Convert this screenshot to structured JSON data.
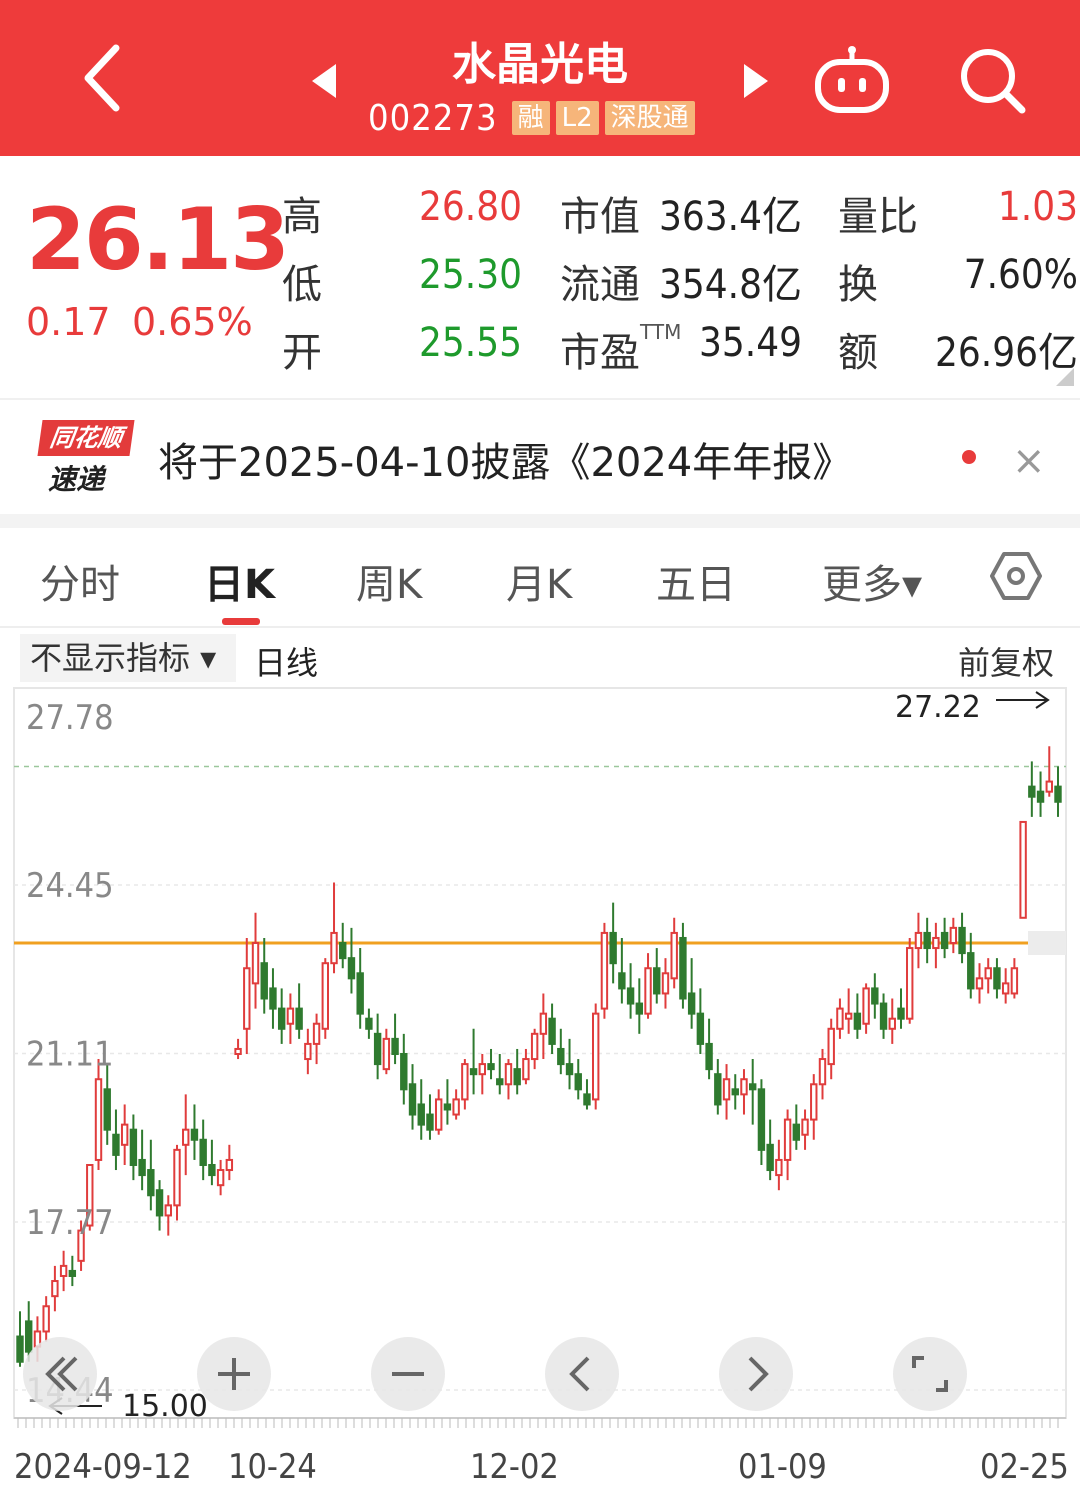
{
  "header": {
    "title": "水晶光电",
    "code": "002273",
    "tags": [
      "融",
      "L2",
      "深股通"
    ]
  },
  "quote": {
    "price": "26.13",
    "change": "0.17",
    "change_pct": "0.65%",
    "stats": {
      "high_label": "高",
      "high": "26.80",
      "low_label": "低",
      "low": "25.30",
      "open_label": "开",
      "open": "25.55",
      "mcap_label": "市值",
      "mcap": "363.4亿",
      "float_label": "流通",
      "float": "354.8亿",
      "pe_label": "市盈",
      "pe_sup": "TTM",
      "pe": "35.49",
      "vol_ratio_label": "量比",
      "vol_ratio": "1.03",
      "turnover_label": "换",
      "turnover": "7.60%",
      "amount_label": "额",
      "amount": "26.96亿"
    }
  },
  "news": {
    "logo_top": "同花顺",
    "logo_bottom": "速递",
    "text": "将于2025-04-10披露《2024年年报》",
    "close": "×"
  },
  "tabs": [
    "分时",
    "日K",
    "周K",
    "月K",
    "五日",
    "更多▾"
  ],
  "active_tab": 1,
  "chart_header": {
    "indicator": "不显示指标 ▾",
    "period": "日线",
    "adjust": "前复权"
  },
  "chart_data": {
    "type": "candlestick",
    "y_ticks": [
      "27.78",
      "24.45",
      "21.11",
      "17.77",
      "14.44"
    ],
    "ylim": [
      14.44,
      27.78
    ],
    "x_ticks": [
      "2024-09-12",
      "10-24",
      "12-02",
      "01-09",
      "02-25"
    ],
    "max_label": "27.22",
    "min_label": "15.00",
    "reference_line": 23.3,
    "candles": [
      [
        15.5,
        16.0,
        14.9,
        15.0
      ],
      [
        15.8,
        16.2,
        15.0,
        15.2
      ],
      [
        15.3,
        15.9,
        15.0,
        15.6
      ],
      [
        15.6,
        16.3,
        15.4,
        16.1
      ],
      [
        16.3,
        16.9,
        16.0,
        16.6
      ],
      [
        16.7,
        17.2,
        16.4,
        16.9
      ],
      [
        16.8,
        17.1,
        16.5,
        16.7
      ],
      [
        17.0,
        17.8,
        16.8,
        17.6
      ],
      [
        17.7,
        18.9,
        17.6,
        18.9
      ],
      [
        19.0,
        21.0,
        18.8,
        20.6
      ],
      [
        20.4,
        20.9,
        19.3,
        19.6
      ],
      [
        19.5,
        20.0,
        18.8,
        19.1
      ],
      [
        19.3,
        20.1,
        18.9,
        19.7
      ],
      [
        19.6,
        19.9,
        18.6,
        18.9
      ],
      [
        19.0,
        19.6,
        18.4,
        18.7
      ],
      [
        18.8,
        19.4,
        18.0,
        18.3
      ],
      [
        18.4,
        18.6,
        17.6,
        17.9
      ],
      [
        17.9,
        18.3,
        17.5,
        18.1
      ],
      [
        18.1,
        19.3,
        17.8,
        19.2
      ],
      [
        19.3,
        20.3,
        18.7,
        19.6
      ],
      [
        19.6,
        20.1,
        19.0,
        19.4
      ],
      [
        19.4,
        19.8,
        18.6,
        18.9
      ],
      [
        18.9,
        19.4,
        18.5,
        18.7
      ],
      [
        18.5,
        19.0,
        18.3,
        18.8
      ],
      [
        18.8,
        19.3,
        18.6,
        19.0
      ],
      [
        21.1,
        21.4,
        21.0,
        21.2
      ],
      [
        21.6,
        23.4,
        21.1,
        22.8
      ],
      [
        22.5,
        23.9,
        22.0,
        23.3
      ],
      [
        22.9,
        23.4,
        21.9,
        22.2
      ],
      [
        22.4,
        22.8,
        21.6,
        22.0
      ],
      [
        22.0,
        22.4,
        21.3,
        21.6
      ],
      [
        21.7,
        22.3,
        21.3,
        22.0
      ],
      [
        22.0,
        22.5,
        21.4,
        21.6
      ],
      [
        21.0,
        21.6,
        20.7,
        21.3
      ],
      [
        21.3,
        21.9,
        20.9,
        21.7
      ],
      [
        21.6,
        23.0,
        21.4,
        22.9
      ],
      [
        22.9,
        24.5,
        22.7,
        23.5
      ],
      [
        23.3,
        23.7,
        22.8,
        23.0
      ],
      [
        23.0,
        23.6,
        22.3,
        22.6
      ],
      [
        22.7,
        23.2,
        21.6,
        21.9
      ],
      [
        21.8,
        22.0,
        21.4,
        21.6
      ],
      [
        21.5,
        21.9,
        20.6,
        20.9
      ],
      [
        20.8,
        21.6,
        20.7,
        21.4
      ],
      [
        21.4,
        21.9,
        20.9,
        21.1
      ],
      [
        21.1,
        21.5,
        20.1,
        20.4
      ],
      [
        20.5,
        20.9,
        19.6,
        19.9
      ],
      [
        20.1,
        20.6,
        19.4,
        19.7
      ],
      [
        19.9,
        20.3,
        19.4,
        19.6
      ],
      [
        19.6,
        20.4,
        19.5,
        20.2
      ],
      [
        20.1,
        20.6,
        19.7,
        20.0
      ],
      [
        19.9,
        20.4,
        19.8,
        20.2
      ],
      [
        20.2,
        21.0,
        20.0,
        20.9
      ],
      [
        20.8,
        21.6,
        20.3,
        20.7
      ],
      [
        20.7,
        21.1,
        20.3,
        20.9
      ],
      [
        20.9,
        21.2,
        20.6,
        20.8
      ],
      [
        20.6,
        21.1,
        20.3,
        20.5
      ],
      [
        20.5,
        21.0,
        20.2,
        20.9
      ],
      [
        20.8,
        21.2,
        20.3,
        20.5
      ],
      [
        20.6,
        21.2,
        20.5,
        21.0
      ],
      [
        21.0,
        21.6,
        20.8,
        21.5
      ],
      [
        21.5,
        22.3,
        21.0,
        21.9
      ],
      [
        21.8,
        22.1,
        21.1,
        21.3
      ],
      [
        21.2,
        21.6,
        20.7,
        20.9
      ],
      [
        20.9,
        21.4,
        20.4,
        20.7
      ],
      [
        20.7,
        21.0,
        20.2,
        20.4
      ],
      [
        20.3,
        20.6,
        20.0,
        20.1
      ],
      [
        20.2,
        22.1,
        20.0,
        21.9
      ],
      [
        22.0,
        23.7,
        21.8,
        23.5
      ],
      [
        23.5,
        24.1,
        22.5,
        22.9
      ],
      [
        22.7,
        23.4,
        22.1,
        22.4
      ],
      [
        22.4,
        22.9,
        21.8,
        22.1
      ],
      [
        22.1,
        22.6,
        21.5,
        21.9
      ],
      [
        21.9,
        23.1,
        21.8,
        22.8
      ],
      [
        22.8,
        23.2,
        22.1,
        22.3
      ],
      [
        22.3,
        23.0,
        22.0,
        22.7
      ],
      [
        22.6,
        23.8,
        22.4,
        23.5
      ],
      [
        23.4,
        23.7,
        22.0,
        22.2
      ],
      [
        22.3,
        23.0,
        21.6,
        21.9
      ],
      [
        21.9,
        22.4,
        21.1,
        21.3
      ],
      [
        21.3,
        21.8,
        20.6,
        20.8
      ],
      [
        20.7,
        21.0,
        19.9,
        20.1
      ],
      [
        20.2,
        20.9,
        19.8,
        20.6
      ],
      [
        20.4,
        20.7,
        20.0,
        20.3
      ],
      [
        20.3,
        20.8,
        19.9,
        20.6
      ],
      [
        20.5,
        21.0,
        19.7,
        20.4
      ],
      [
        20.4,
        20.6,
        18.9,
        19.2
      ],
      [
        19.3,
        19.8,
        18.6,
        18.8
      ],
      [
        18.7,
        19.4,
        18.4,
        19.0
      ],
      [
        19.0,
        20.0,
        18.6,
        19.8
      ],
      [
        19.7,
        20.1,
        19.2,
        19.4
      ],
      [
        19.5,
        20.0,
        19.2,
        19.8
      ],
      [
        19.8,
        20.7,
        19.4,
        20.5
      ],
      [
        20.5,
        21.2,
        20.2,
        21.0
      ],
      [
        20.9,
        21.8,
        20.6,
        21.6
      ],
      [
        21.6,
        22.2,
        21.4,
        22.0
      ],
      [
        21.8,
        22.4,
        21.5,
        21.9
      ],
      [
        21.9,
        22.3,
        21.4,
        21.6
      ],
      [
        21.7,
        22.5,
        21.5,
        22.4
      ],
      [
        22.4,
        22.7,
        21.8,
        22.1
      ],
      [
        22.1,
        22.3,
        21.4,
        21.6
      ],
      [
        21.6,
        22.2,
        21.3,
        21.8
      ],
      [
        22.0,
        22.4,
        21.6,
        21.8
      ],
      [
        21.8,
        23.4,
        21.7,
        23.2
      ],
      [
        23.2,
        23.9,
        22.8,
        23.5
      ],
      [
        23.5,
        23.8,
        22.9,
        23.2
      ],
      [
        23.2,
        23.7,
        22.8,
        23.4
      ],
      [
        23.5,
        23.8,
        23.0,
        23.2
      ],
      [
        23.3,
        23.8,
        23.1,
        23.6
      ],
      [
        23.6,
        23.9,
        22.9,
        23.1
      ],
      [
        23.1,
        23.5,
        22.2,
        22.4
      ],
      [
        22.4,
        22.9,
        22.1,
        22.6
      ],
      [
        22.6,
        23.0,
        22.3,
        22.8
      ],
      [
        22.8,
        23.0,
        22.2,
        22.4
      ],
      [
        22.3,
        22.8,
        22.1,
        22.5
      ],
      [
        22.3,
        23.0,
        22.2,
        22.8
      ],
      [
        23.8,
        25.7,
        23.8,
        25.7
      ],
      [
        26.4,
        26.9,
        25.8,
        26.2
      ],
      [
        26.3,
        26.7,
        25.8,
        26.1
      ],
      [
        26.3,
        27.2,
        26.2,
        26.5
      ],
      [
        26.4,
        26.8,
        25.8,
        26.1
      ]
    ]
  }
}
